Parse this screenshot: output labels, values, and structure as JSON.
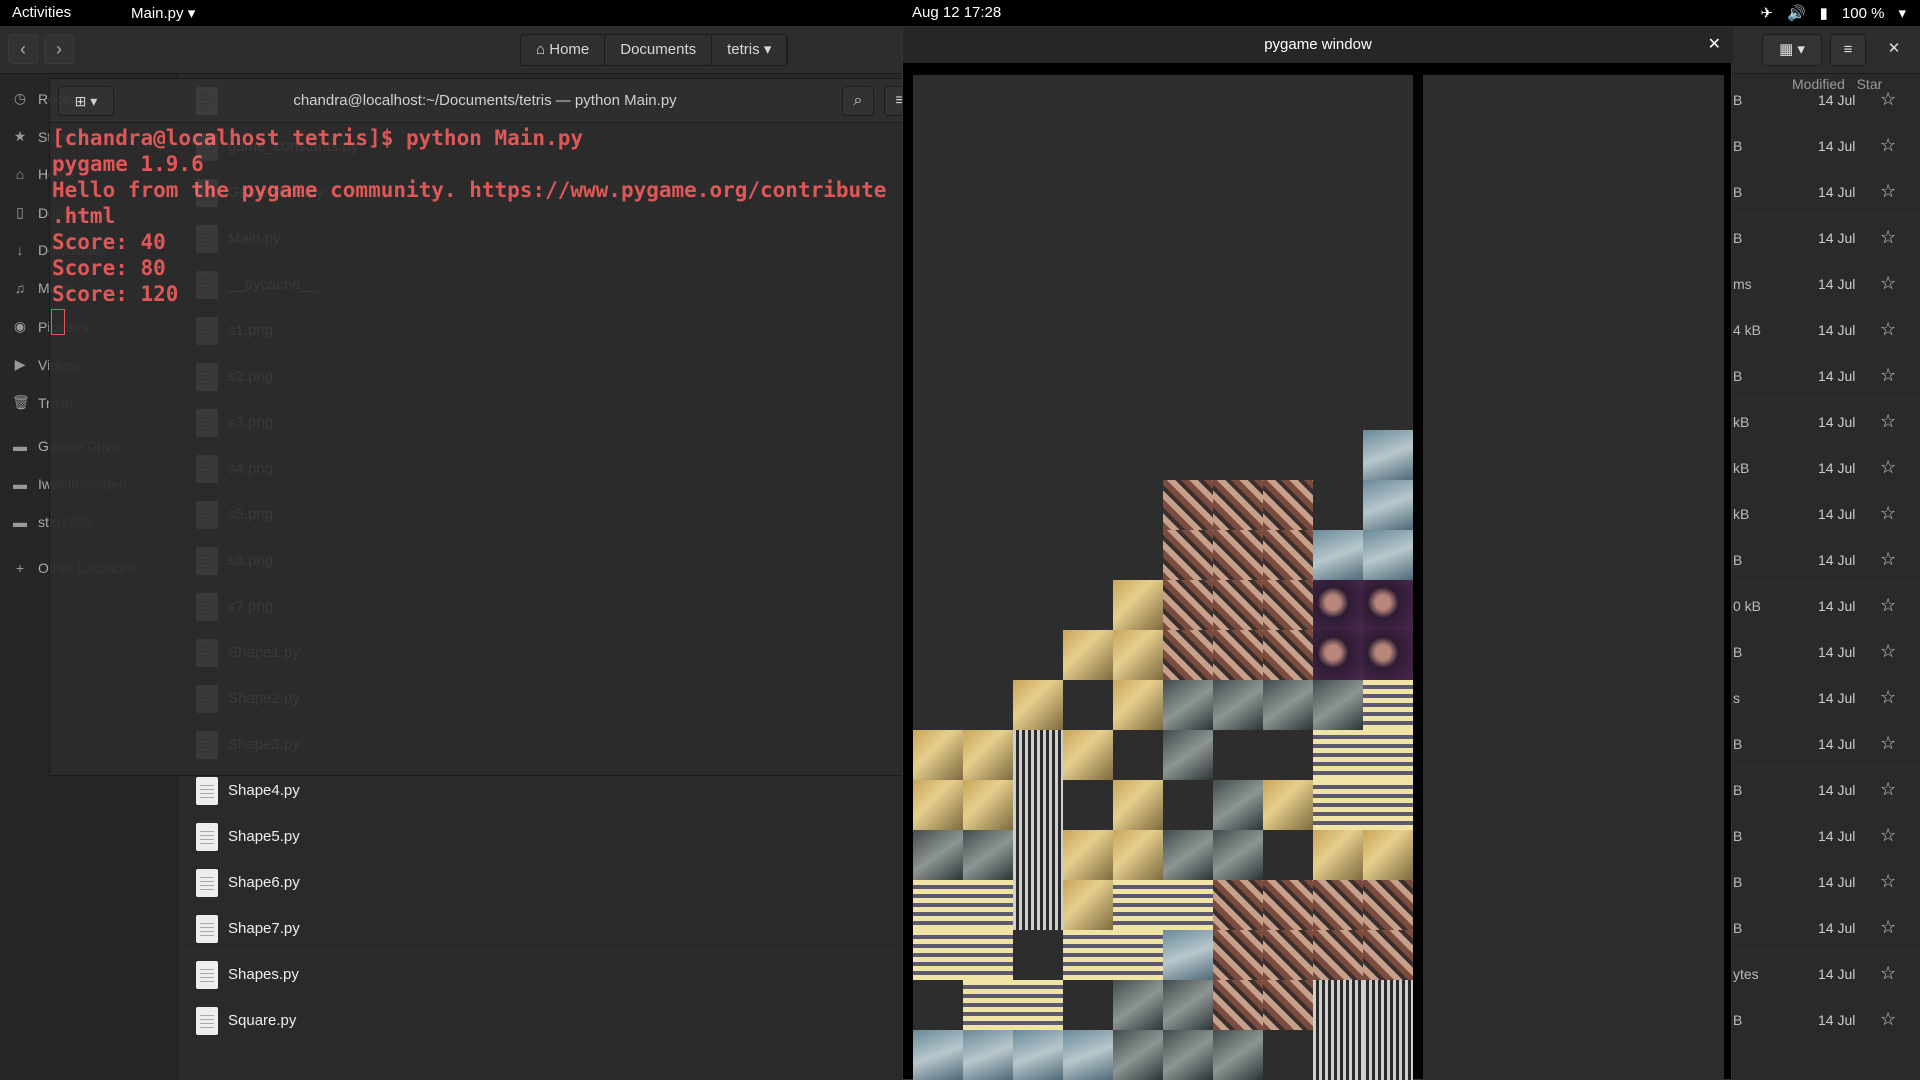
{
  "topbar": {
    "activities": "Activities",
    "app_menu": "Main.py ▾",
    "clock": "Aug 12  17:28",
    "battery": "100 %"
  },
  "files": {
    "breadcrumbs": [
      "Home",
      "Documents",
      "tetris"
    ],
    "column_modified": "Modified",
    "column_star": "Star",
    "sidebar": [
      {
        "label": "Recent",
        "icon": "clock-icon"
      },
      {
        "label": "Starred",
        "icon": "star-icon"
      },
      {
        "label": "Home",
        "icon": "home-icon"
      },
      {
        "label": "Documents",
        "icon": "document-icon"
      },
      {
        "label": "Downloads",
        "icon": "download-icon"
      },
      {
        "label": "Music",
        "icon": "music-icon"
      },
      {
        "label": "Pictures",
        "icon": "camera-icon"
      },
      {
        "label": "Videos",
        "icon": "video-icon"
      },
      {
        "label": "Trash",
        "icon": "trash-icon"
      },
      {
        "label": "Google Drive",
        "icon": "folder-icon"
      },
      {
        "label": "Iwantthisvideo",
        "icon": "folder-icon"
      },
      {
        "label": "stats260",
        "icon": "folder-icon"
      },
      {
        "label": "Other Locations",
        "icon": "plus-icon"
      }
    ],
    "rows": [
      {
        "name": "",
        "size": "B",
        "modified": "14 Jul"
      },
      {
        "name": "game_constants.py",
        "size": "B",
        "modified": "14 Jul"
      },
      {
        "name": "GameState.py",
        "size": "B",
        "modified": "14 Jul"
      },
      {
        "name": "Main.py",
        "size": "B",
        "modified": "14 Jul"
      },
      {
        "name": "__pycache__",
        "size": "ms",
        "modified": "14 Jul"
      },
      {
        "name": "s1.png",
        "size": "4 kB",
        "modified": "14 Jul"
      },
      {
        "name": "s2.png",
        "size": "B",
        "modified": "14 Jul"
      },
      {
        "name": "s3.png",
        "size": "kB",
        "modified": "14 Jul"
      },
      {
        "name": "s4.png",
        "size": "kB",
        "modified": "14 Jul"
      },
      {
        "name": "s5.png",
        "size": "kB",
        "modified": "14 Jul"
      },
      {
        "name": "s6.png",
        "size": "B",
        "modified": "14 Jul"
      },
      {
        "name": "s7.png",
        "size": "0 kB",
        "modified": "14 Jul"
      },
      {
        "name": "Shape1.py",
        "size": "B",
        "modified": "14 Jul"
      },
      {
        "name": "Shape2.py",
        "size": "s",
        "modified": "14 Jul"
      },
      {
        "name": "Shape3.py",
        "size": "B",
        "modified": "14 Jul"
      },
      {
        "name": "Shape4.py",
        "size": "B",
        "modified": "14 Jul"
      },
      {
        "name": "Shape5.py",
        "size": "B",
        "modified": "14 Jul"
      },
      {
        "name": "Shape6.py",
        "size": "B",
        "modified": "14 Jul"
      },
      {
        "name": "Shape7.py",
        "size": "B",
        "modified": "14 Jul"
      },
      {
        "name": "Shapes.py",
        "size": "ytes",
        "modified": "14 Jul"
      },
      {
        "name": "Square.py",
        "size": "B",
        "modified": "14 Jul"
      }
    ]
  },
  "terminal": {
    "title": "chandra@localhost:~/Documents/tetris — python Main.py",
    "lines": [
      "[chandra@localhost tetris]$ python Main.py",
      "pygame 1.9.6",
      "Hello from the pygame community. https://www.pygame.org/contribute",
      ".html",
      "Score: 40",
      "Score: 80",
      "Score: 120"
    ]
  },
  "pygame": {
    "title": "pygame window",
    "board": [
      "...........",
      "...........",
      "...........",
      "...........",
      "...........",
      "...........",
      "...........",
      "...........",
      "..........",
      "..........",
      "..........",
      "..........",
      "..........",
      "..........",
      "..........",
      "..........",
      "..........",
      "..........",
      "..........",
      ".........",
      "..........",
      "..........",
      "..........",
      "..........",
      "..........",
      "..........",
      "..........",
      "..........",
      "..........",
      "..........",
      "..........",
      "..........",
      "..........",
      "..........",
      "..........",
      "..........",
      "..........",
      "..........",
      "..........",
      ".........."
    ]
  }
}
